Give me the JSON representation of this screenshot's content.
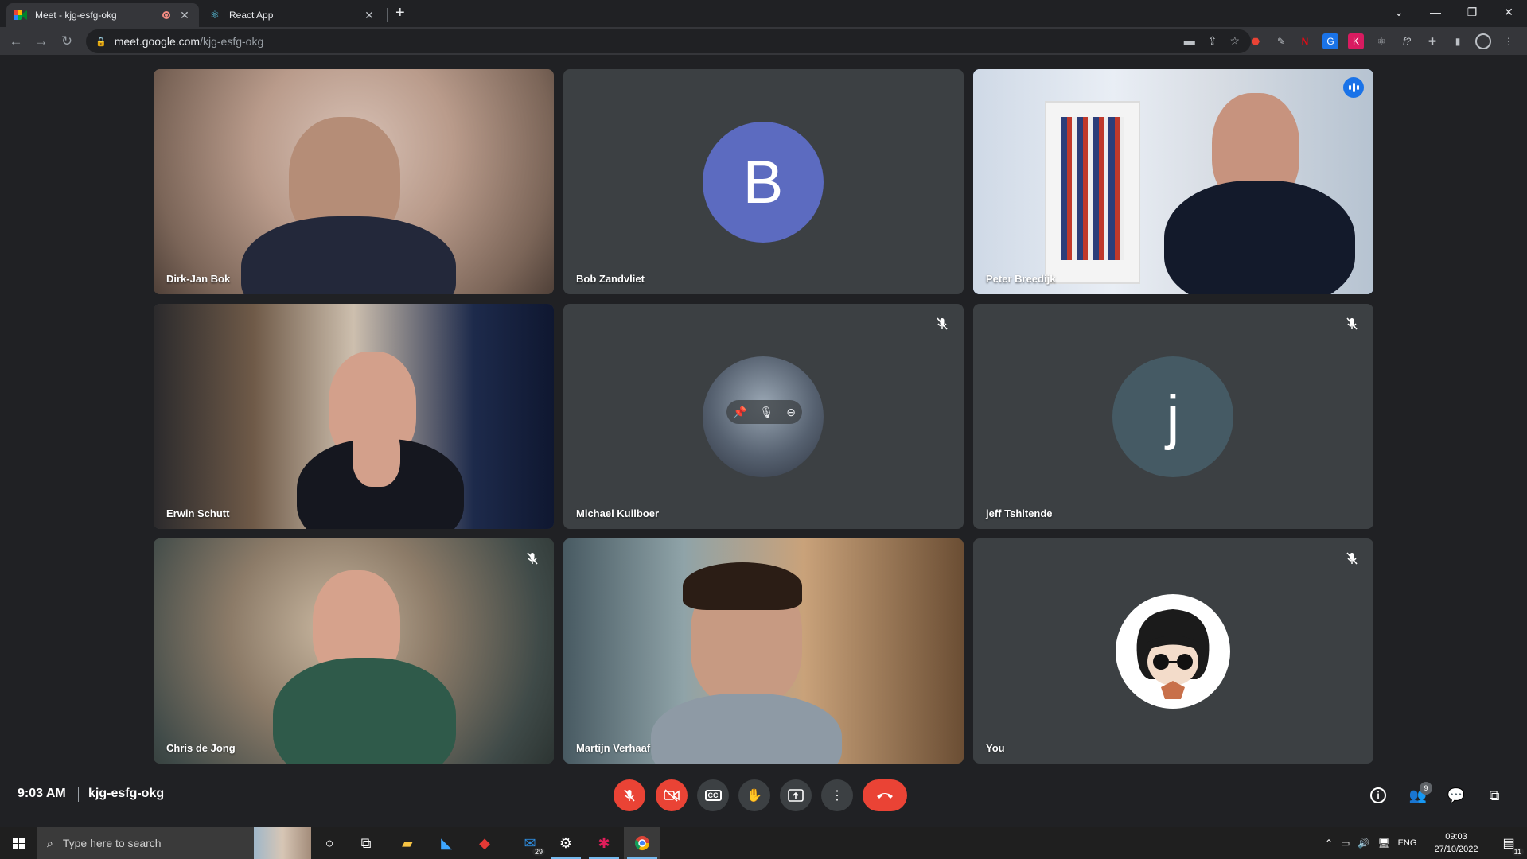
{
  "browser": {
    "tabs": [
      {
        "title": "Meet - kjg-esfg-okg",
        "favicon": "google-meet-icon",
        "recording": true
      },
      {
        "title": "React App",
        "favicon": "react-icon",
        "recording": false
      }
    ],
    "url_host": "meet.google.com",
    "url_path": "/kjg-esfg-okg"
  },
  "participants": [
    {
      "name": "Dirk-Jan Bok",
      "type": "video",
      "muted": false
    },
    {
      "name": "Bob Zandvliet",
      "type": "initial",
      "initial": "B",
      "avatar_color": "#5c6bc0",
      "muted": false
    },
    {
      "name": "Peter Breedijk",
      "type": "video",
      "muted": false,
      "speaking": true
    },
    {
      "name": "Erwin Schutt",
      "type": "video",
      "muted": false
    },
    {
      "name": "Michael Kuilboer",
      "type": "photo-avatar",
      "muted": true
    },
    {
      "name": "jeff Tshitende",
      "type": "initial",
      "initial": "j",
      "avatar_color": "#455a64",
      "muted": true
    },
    {
      "name": "Chris de Jong",
      "type": "video",
      "muted": true
    },
    {
      "name": "Martijn Verhaaf",
      "type": "video",
      "muted": false
    },
    {
      "name": "You",
      "type": "photo-avatar",
      "muted": true
    }
  ],
  "meeting": {
    "time": "9:03 AM",
    "code": "kjg-esfg-okg",
    "participant_count": "9"
  },
  "taskbar": {
    "search_placeholder": "Type here to search",
    "mail_badge": "29",
    "language": "ENG",
    "time": "09:03",
    "date": "27/10/2022",
    "notification_count": "11"
  }
}
